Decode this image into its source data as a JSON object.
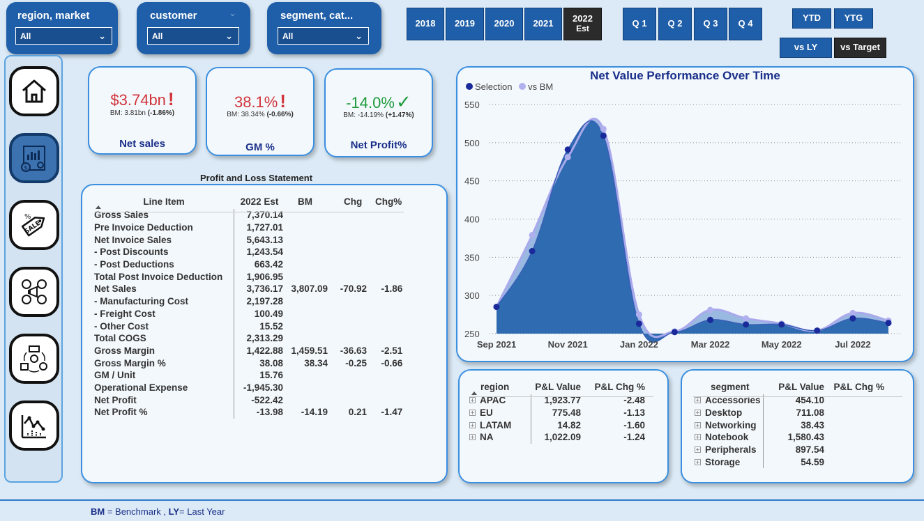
{
  "slicers": [
    {
      "title": "region, market",
      "value": "All"
    },
    {
      "title": "customer",
      "value": "All"
    },
    {
      "title": "segment, cat...",
      "value": "All"
    }
  ],
  "years": [
    {
      "label": "2018",
      "selected": false
    },
    {
      "label": "2019",
      "selected": false
    },
    {
      "label": "2020",
      "selected": false
    },
    {
      "label": "2021",
      "selected": false
    },
    {
      "label": "2022",
      "sublabel": "Est",
      "selected": true
    }
  ],
  "quarters": [
    "Q 1",
    "Q 2",
    "Q 3",
    "Q 4"
  ],
  "period_buttons": {
    "ytd": "YTD",
    "ytg": "YTG"
  },
  "compare_buttons": {
    "vs_ly": "vs LY",
    "vs_target": "vs Target"
  },
  "nav": {
    "items": [
      {
        "name": "home-icon",
        "active": false
      },
      {
        "name": "finance-report-icon",
        "active": true
      },
      {
        "name": "sale-tag-icon",
        "active": false
      },
      {
        "name": "marketing-social-icon",
        "active": false
      },
      {
        "name": "supply-chain-icon",
        "active": false
      },
      {
        "name": "executive-chart-icon",
        "active": false
      }
    ]
  },
  "kpis": [
    {
      "value": "$3.74bn",
      "status": "!",
      "status_color": "#d1343a",
      "value_color": "#d1343a",
      "bm_text": "BM: 3.81bn",
      "bm_change": "(-1.86%)",
      "name": "Net sales"
    },
    {
      "value": "38.1%",
      "status": "!",
      "status_color": "#d1343a",
      "value_color": "#d1343a",
      "bm_text": "BM: 38.34%",
      "bm_change": "(-0.66%)",
      "name": "GM %"
    },
    {
      "value": "-14.0%",
      "status": "✓",
      "status_color": "#1e9b3c",
      "value_color": "#1e9b3c",
      "bm_text": "BM: -14.19%",
      "bm_change": "(+1.47%)",
      "name": "Net Profit%"
    }
  ],
  "pl": {
    "title": "Profit and Loss Statement",
    "columns": [
      "Line Item",
      "2022 Est",
      "BM",
      "Chg",
      "Chg%"
    ],
    "rows": [
      [
        "Gross Sales",
        "7,370.14",
        "",
        "",
        ""
      ],
      [
        "Pre Invoice Deduction",
        "1,727.01",
        "",
        "",
        ""
      ],
      [
        "Net Invoice Sales",
        "5,643.13",
        "",
        "",
        ""
      ],
      [
        "- Post Discounts",
        "1,243.54",
        "",
        "",
        ""
      ],
      [
        "- Post Deductions",
        "663.42",
        "",
        "",
        ""
      ],
      [
        "Total Post Invoice Deduction",
        "1,906.95",
        "",
        "",
        ""
      ],
      [
        "Net Sales",
        "3,736.17",
        "3,807.09",
        "-70.92",
        "-1.86"
      ],
      [
        "- Manufacturing Cost",
        "2,197.28",
        "",
        "",
        ""
      ],
      [
        "- Freight Cost",
        "100.49",
        "",
        "",
        ""
      ],
      [
        "- Other Cost",
        "15.52",
        "",
        "",
        ""
      ],
      [
        "Total COGS",
        "2,313.29",
        "",
        "",
        ""
      ],
      [
        "Gross Margin",
        "1,422.88",
        "1,459.51",
        "-36.63",
        "-2.51"
      ],
      [
        "Gross Margin %",
        "38.08",
        "38.34",
        "-0.25",
        "-0.66"
      ],
      [
        "GM / Unit",
        "15.76",
        "",
        "",
        ""
      ],
      [
        "Operational Expense",
        "-1,945.30",
        "",
        "",
        ""
      ],
      [
        "Net Profit",
        "-522.42",
        "",
        "",
        ""
      ],
      [
        "Net Profit %",
        "-13.98",
        "-14.19",
        "0.21",
        "-1.47"
      ]
    ]
  },
  "chart_data": {
    "type": "area",
    "title": "Net Value Performance Over Time",
    "series": [
      {
        "name": "Selection",
        "color": "#1a2a9a",
        "values": [
          285,
          358,
          491,
          509,
          263,
          252,
          268,
          262,
          262,
          254,
          270,
          264
        ]
      },
      {
        "name": "vs BM",
        "color": "#b0b0ee",
        "values": [
          285,
          379,
          481,
          518,
          275,
          253,
          281,
          270,
          263,
          254,
          277,
          267
        ]
      }
    ],
    "x": [
      "2021-09",
      "2021-10",
      "2021-11",
      "2021-12",
      "2022-01",
      "2022-02",
      "2022-03",
      "2022-04",
      "2022-05",
      "2022-06",
      "2022-07",
      "2022-08"
    ],
    "x_tick_labels": [
      "Sep 2021",
      "Nov 2021",
      "Jan 2022",
      "Mar 2022",
      "May 2022",
      "Jul 2022"
    ],
    "y_ticks": [
      250,
      300,
      350,
      400,
      450,
      500,
      550
    ],
    "ylim": [
      250,
      550
    ],
    "grid": true,
    "legend": "top-left",
    "fill_color": "#2e6bb0"
  },
  "region_table": {
    "columns": [
      "region",
      "P&L Value",
      "P&L Chg %"
    ],
    "rows": [
      [
        "APAC",
        "1,923.77",
        "-2.48"
      ],
      [
        "EU",
        "775.48",
        "-1.13"
      ],
      [
        "LATAM",
        "14.82",
        "-1.60"
      ],
      [
        "NA",
        "1,022.09",
        "-1.24"
      ]
    ]
  },
  "segment_table": {
    "columns": [
      "segment",
      "P&L Value",
      "P&L Chg %"
    ],
    "rows": [
      [
        "Accessories",
        "454.10",
        ""
      ],
      [
        "Desktop",
        "711.08",
        ""
      ],
      [
        "Networking",
        "38.43",
        ""
      ],
      [
        "Notebook",
        "1,580.43",
        ""
      ],
      [
        "Peripherals",
        "897.54",
        ""
      ],
      [
        "Storage",
        "54.59",
        ""
      ]
    ]
  },
  "footer": {
    "bm": "BM",
    "bm_text": " = Benchmark , ",
    "ly": "LY",
    "ly_text": "= Last Year"
  }
}
